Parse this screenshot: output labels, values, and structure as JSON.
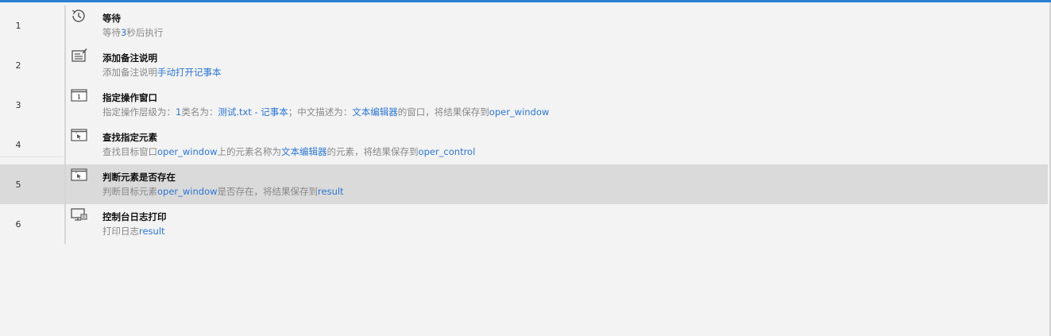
{
  "steps": [
    {
      "num": "1",
      "icon": "clock-icon",
      "title": "等待",
      "desc": [
        {
          "t": "等待",
          "hl": false
        },
        {
          "t": "3",
          "hl": true
        },
        {
          "t": "秒后执行",
          "hl": false
        }
      ]
    },
    {
      "num": "2",
      "icon": "note-edit-icon",
      "title": "添加备注说明",
      "desc": [
        {
          "t": "添加备注说明",
          "hl": false
        },
        {
          "t": "手动打开记事本",
          "hl": true
        }
      ]
    },
    {
      "num": "3",
      "icon": "window-info-icon",
      "title": "指定操作窗口",
      "desc": [
        {
          "t": "指定操作层级为：",
          "hl": false
        },
        {
          "t": "1",
          "hl": true
        },
        {
          "t": "类名为：",
          "hl": false
        },
        {
          "t": "测试.txt - 记事本",
          "hl": true
        },
        {
          "t": "；中文描述为：",
          "hl": false
        },
        {
          "t": "文本编辑器",
          "hl": true
        },
        {
          "t": "的窗口，将结果保存到",
          "hl": false
        },
        {
          "t": "oper_window",
          "hl": true
        }
      ]
    },
    {
      "num": "4",
      "icon": "find-element-icon",
      "title": "查找指定元素",
      "desc": [
        {
          "t": "查找目标窗口",
          "hl": false
        },
        {
          "t": "oper_window",
          "hl": true
        },
        {
          "t": "上的元素名称为",
          "hl": false
        },
        {
          "t": "文本编辑器",
          "hl": true
        },
        {
          "t": "的元素，将结果保存到",
          "hl": false
        },
        {
          "t": "oper_control",
          "hl": true
        }
      ]
    },
    {
      "num": "5",
      "icon": "element-exists-icon",
      "title": "判断元素是否存在",
      "selected": true,
      "desc": [
        {
          "t": "判断目标元素",
          "hl": false
        },
        {
          "t": "oper_window",
          "hl": true
        },
        {
          "t": "是否存在，将结果保存到",
          "hl": false
        },
        {
          "t": "result",
          "hl": true
        }
      ]
    },
    {
      "num": "6",
      "icon": "console-print-icon",
      "title": "控制台日志打印",
      "desc": [
        {
          "t": "打印日志",
          "hl": false
        },
        {
          "t": "result",
          "hl": true
        }
      ]
    }
  ]
}
